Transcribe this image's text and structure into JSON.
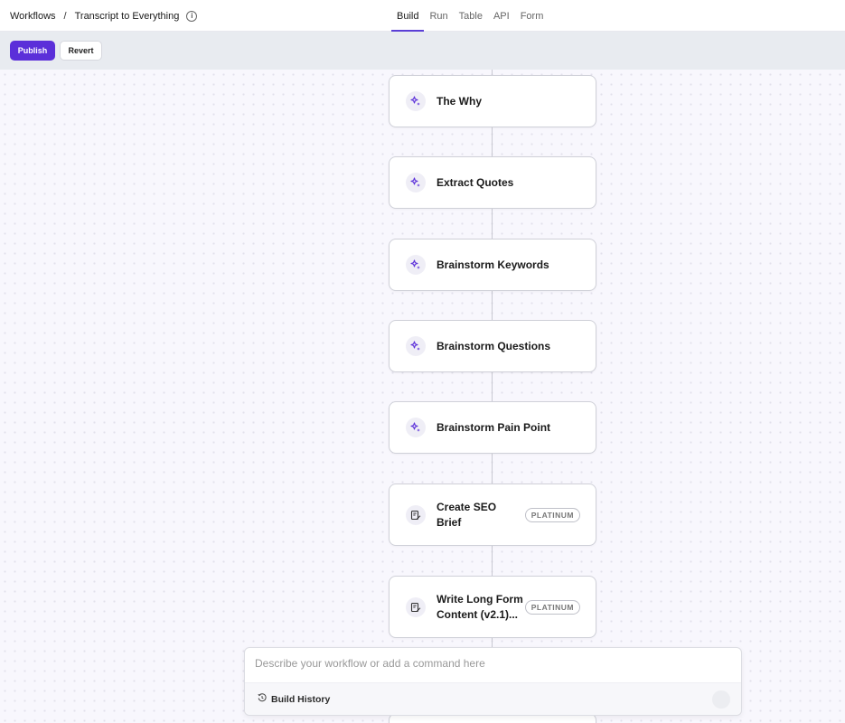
{
  "breadcrumb": {
    "root": "Workflows",
    "separator": "/",
    "current": "Transcript to Everything"
  },
  "tabs": [
    {
      "label": "Build",
      "active": true
    },
    {
      "label": "Run",
      "active": false
    },
    {
      "label": "Table",
      "active": false
    },
    {
      "label": "API",
      "active": false
    },
    {
      "label": "Form",
      "active": false
    }
  ],
  "toolbar": {
    "publish_label": "Publish",
    "revert_label": "Revert"
  },
  "nodes": [
    {
      "label": "The Why",
      "icon": "sparkle-icon"
    },
    {
      "label": "Extract Quotes",
      "icon": "sparkle-icon"
    },
    {
      "label": "Brainstorm Keywords",
      "icon": "sparkle-icon"
    },
    {
      "label": "Brainstorm Questions",
      "icon": "sparkle-icon"
    },
    {
      "label": "Brainstorm Pain Point",
      "icon": "sparkle-icon"
    },
    {
      "label_line1": "Create SEO",
      "label_line2": "Brief",
      "icon": "document-edit-icon",
      "badge": "PLATINUM"
    },
    {
      "label_line1": "Write Long Form",
      "label_line2": "Content (v2.1)...",
      "icon": "document-edit-icon",
      "badge": "PLATINUM"
    }
  ],
  "command": {
    "placeholder": "Describe your workflow or add a command here",
    "build_history_label": "Build History"
  },
  "colors": {
    "accent": "#5b2fd9",
    "canvas_bg": "#f8f7fd",
    "toolbar_bg": "#e8ebf0"
  }
}
